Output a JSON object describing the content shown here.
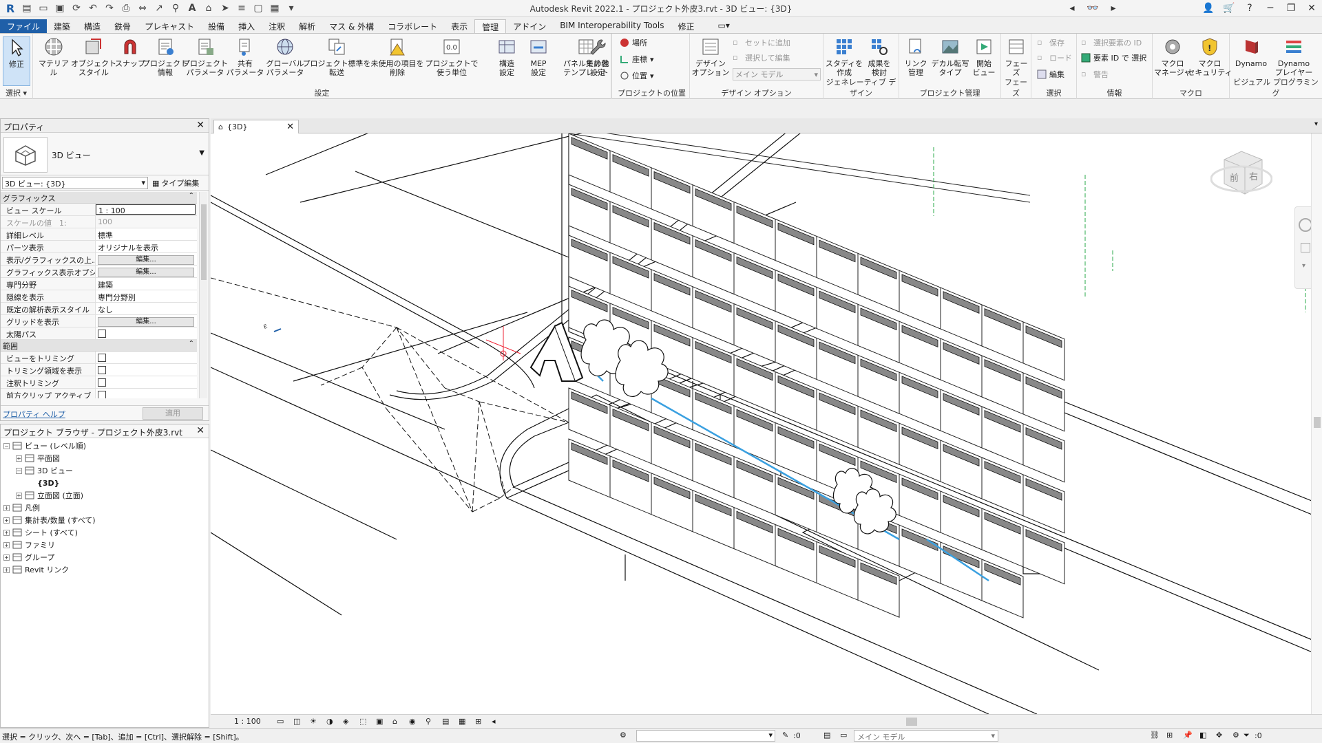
{
  "titlebar": {
    "title": "Autodesk Revit 2022.1 - プロジェクト外皮3.rvt - 3D ビュー: {3D}"
  },
  "tabs": [
    "ファイル",
    "建築",
    "構造",
    "鉄骨",
    "プレキャスト",
    "設備",
    "挿入",
    "注釈",
    "解析",
    "マス & 外構",
    "コラボレート",
    "表示",
    "管理",
    "アドイン",
    "BIM Interoperability Tools",
    "修正"
  ],
  "ribbon": {
    "select_panel": {
      "modify": "修正",
      "title": "選択"
    },
    "settings_panel": {
      "title": "設定",
      "buttons": [
        "マテリアル",
        "オブジェクト\nスタイル",
        "スナップ",
        "プロジェクト\n情報",
        "プロジェクト\nパラメータ",
        "共有\nパラメータ",
        "グローバル\nパラメータ",
        "プロジェクト標準を\n転送",
        "未使用の項目を\n削除",
        "プロジェクトで\n使う単位"
      ],
      "more": [
        "構造\n設定",
        "MEP\n設定",
        "パネル集計表\nテンプレート",
        "その他\n設定"
      ]
    },
    "location_panel": {
      "title": "プロジェクトの位置",
      "items": [
        "場所",
        "座標",
        "位置"
      ]
    },
    "design_panel": {
      "title": "デザイン オプション",
      "button": "デザイン\nオプション",
      "add": "セットに追加",
      "pick": "選択して編集",
      "main": "メイン モデル"
    },
    "generative_panel": {
      "title": "ジェネレーティブ デザイン",
      "buttons": [
        "スタディを\n作成",
        "成果を\n検討"
      ]
    },
    "manage_panel": {
      "title": "プロジェクト管理",
      "buttons": [
        "リンク\n管理",
        "デカル転写\nタイプ",
        "開始\nビュー"
      ]
    },
    "phase_panel": {
      "title": "フェーズ",
      "button": "フェーズ"
    },
    "select2_panel": {
      "title": "選択",
      "items": [
        "保存",
        "ロード",
        "編集"
      ]
    },
    "info_panel": {
      "title": "情報",
      "items": [
        "選択要素の ID",
        "要素 ID で 選択",
        "警告"
      ]
    },
    "macro_panel": {
      "title": "マクロ",
      "buttons": [
        "マクロ\nマネージャ",
        "マクロ\nセキュリティ"
      ]
    },
    "visual_panel": {
      "title": "ビジュアル プログラミング",
      "buttons": [
        "Dynamo",
        "Dynamo\nプレイヤー"
      ]
    }
  },
  "properties": {
    "title": "プロパティ",
    "type_name": "3D ビュー",
    "instance": "3D ビュー: {3D}",
    "type_edit": "タイプ編集",
    "groups": [
      {
        "name": "グラフィックス",
        "rows": [
          {
            "label": "ビュー スケール",
            "value": "1 : 100",
            "kind": "boxed"
          },
          {
            "label": "スケールの値　1:",
            "value": "100",
            "kind": "gray"
          },
          {
            "label": "詳細レベル",
            "value": "標準"
          },
          {
            "label": "パーツ表示",
            "value": "オリジナルを表示"
          },
          {
            "label": "表示/グラフィックスの上...",
            "value": "編集...",
            "kind": "button"
          },
          {
            "label": "グラフィックス表示オプション",
            "value": "編集...",
            "kind": "button"
          },
          {
            "label": "専門分野",
            "value": "建築"
          },
          {
            "label": "隠線を表示",
            "value": "専門分野別"
          },
          {
            "label": "既定の解析表示スタイル",
            "value": "なし"
          },
          {
            "label": "グリッドを表示",
            "value": "編集...",
            "kind": "button"
          },
          {
            "label": "太陽パス",
            "value": "",
            "kind": "check"
          }
        ]
      },
      {
        "name": "範囲",
        "rows": [
          {
            "label": "ビューをトリミング",
            "value": "",
            "kind": "check"
          },
          {
            "label": "トリミング領域を表示",
            "value": "",
            "kind": "check"
          },
          {
            "label": "注釈トリミング",
            "value": "",
            "kind": "check"
          },
          {
            "label": "前方クリップ アクティブ",
            "value": "",
            "kind": "check"
          }
        ]
      }
    ],
    "help": "プロパティ ヘルプ",
    "apply": "適用"
  },
  "browser": {
    "title": "プロジェクト ブラウザ - プロジェクト外皮3.rvt",
    "items": [
      {
        "label": "ビュー (レベル順)",
        "level": 0,
        "exp": "−"
      },
      {
        "label": "平面図",
        "level": 1,
        "exp": "+"
      },
      {
        "label": "3D ビュー",
        "level": 1,
        "exp": "−"
      },
      {
        "label": "{3D}",
        "level": 2,
        "exp": "",
        "bold": true
      },
      {
        "label": "立面図 (立面)",
        "level": 1,
        "exp": "+"
      },
      {
        "label": "凡例",
        "level": 0,
        "exp": "+"
      },
      {
        "label": "集計表/数量 (すべて)",
        "level": 0,
        "exp": "+"
      },
      {
        "label": "シート (すべて)",
        "level": 0,
        "exp": "+"
      },
      {
        "label": "ファミリ",
        "level": 0,
        "exp": "+"
      },
      {
        "label": "グループ",
        "level": 0,
        "exp": "+"
      },
      {
        "label": "Revit リンク",
        "level": 0,
        "exp": "+"
      }
    ]
  },
  "view": {
    "tab": "{3D}",
    "scale": "1 : 100",
    "viewcube": [
      "前",
      "右"
    ]
  },
  "status": {
    "text": "選択 = クリック、次へ = [Tab]、追加 = [Ctrl]、選択解除 = [Shift]。",
    "count": ":0",
    "model": "メイン モデル",
    "filter": ":0"
  },
  "colors": {
    "accent": "#1f5fa8",
    "selection_blue": "#3aa0e0"
  }
}
